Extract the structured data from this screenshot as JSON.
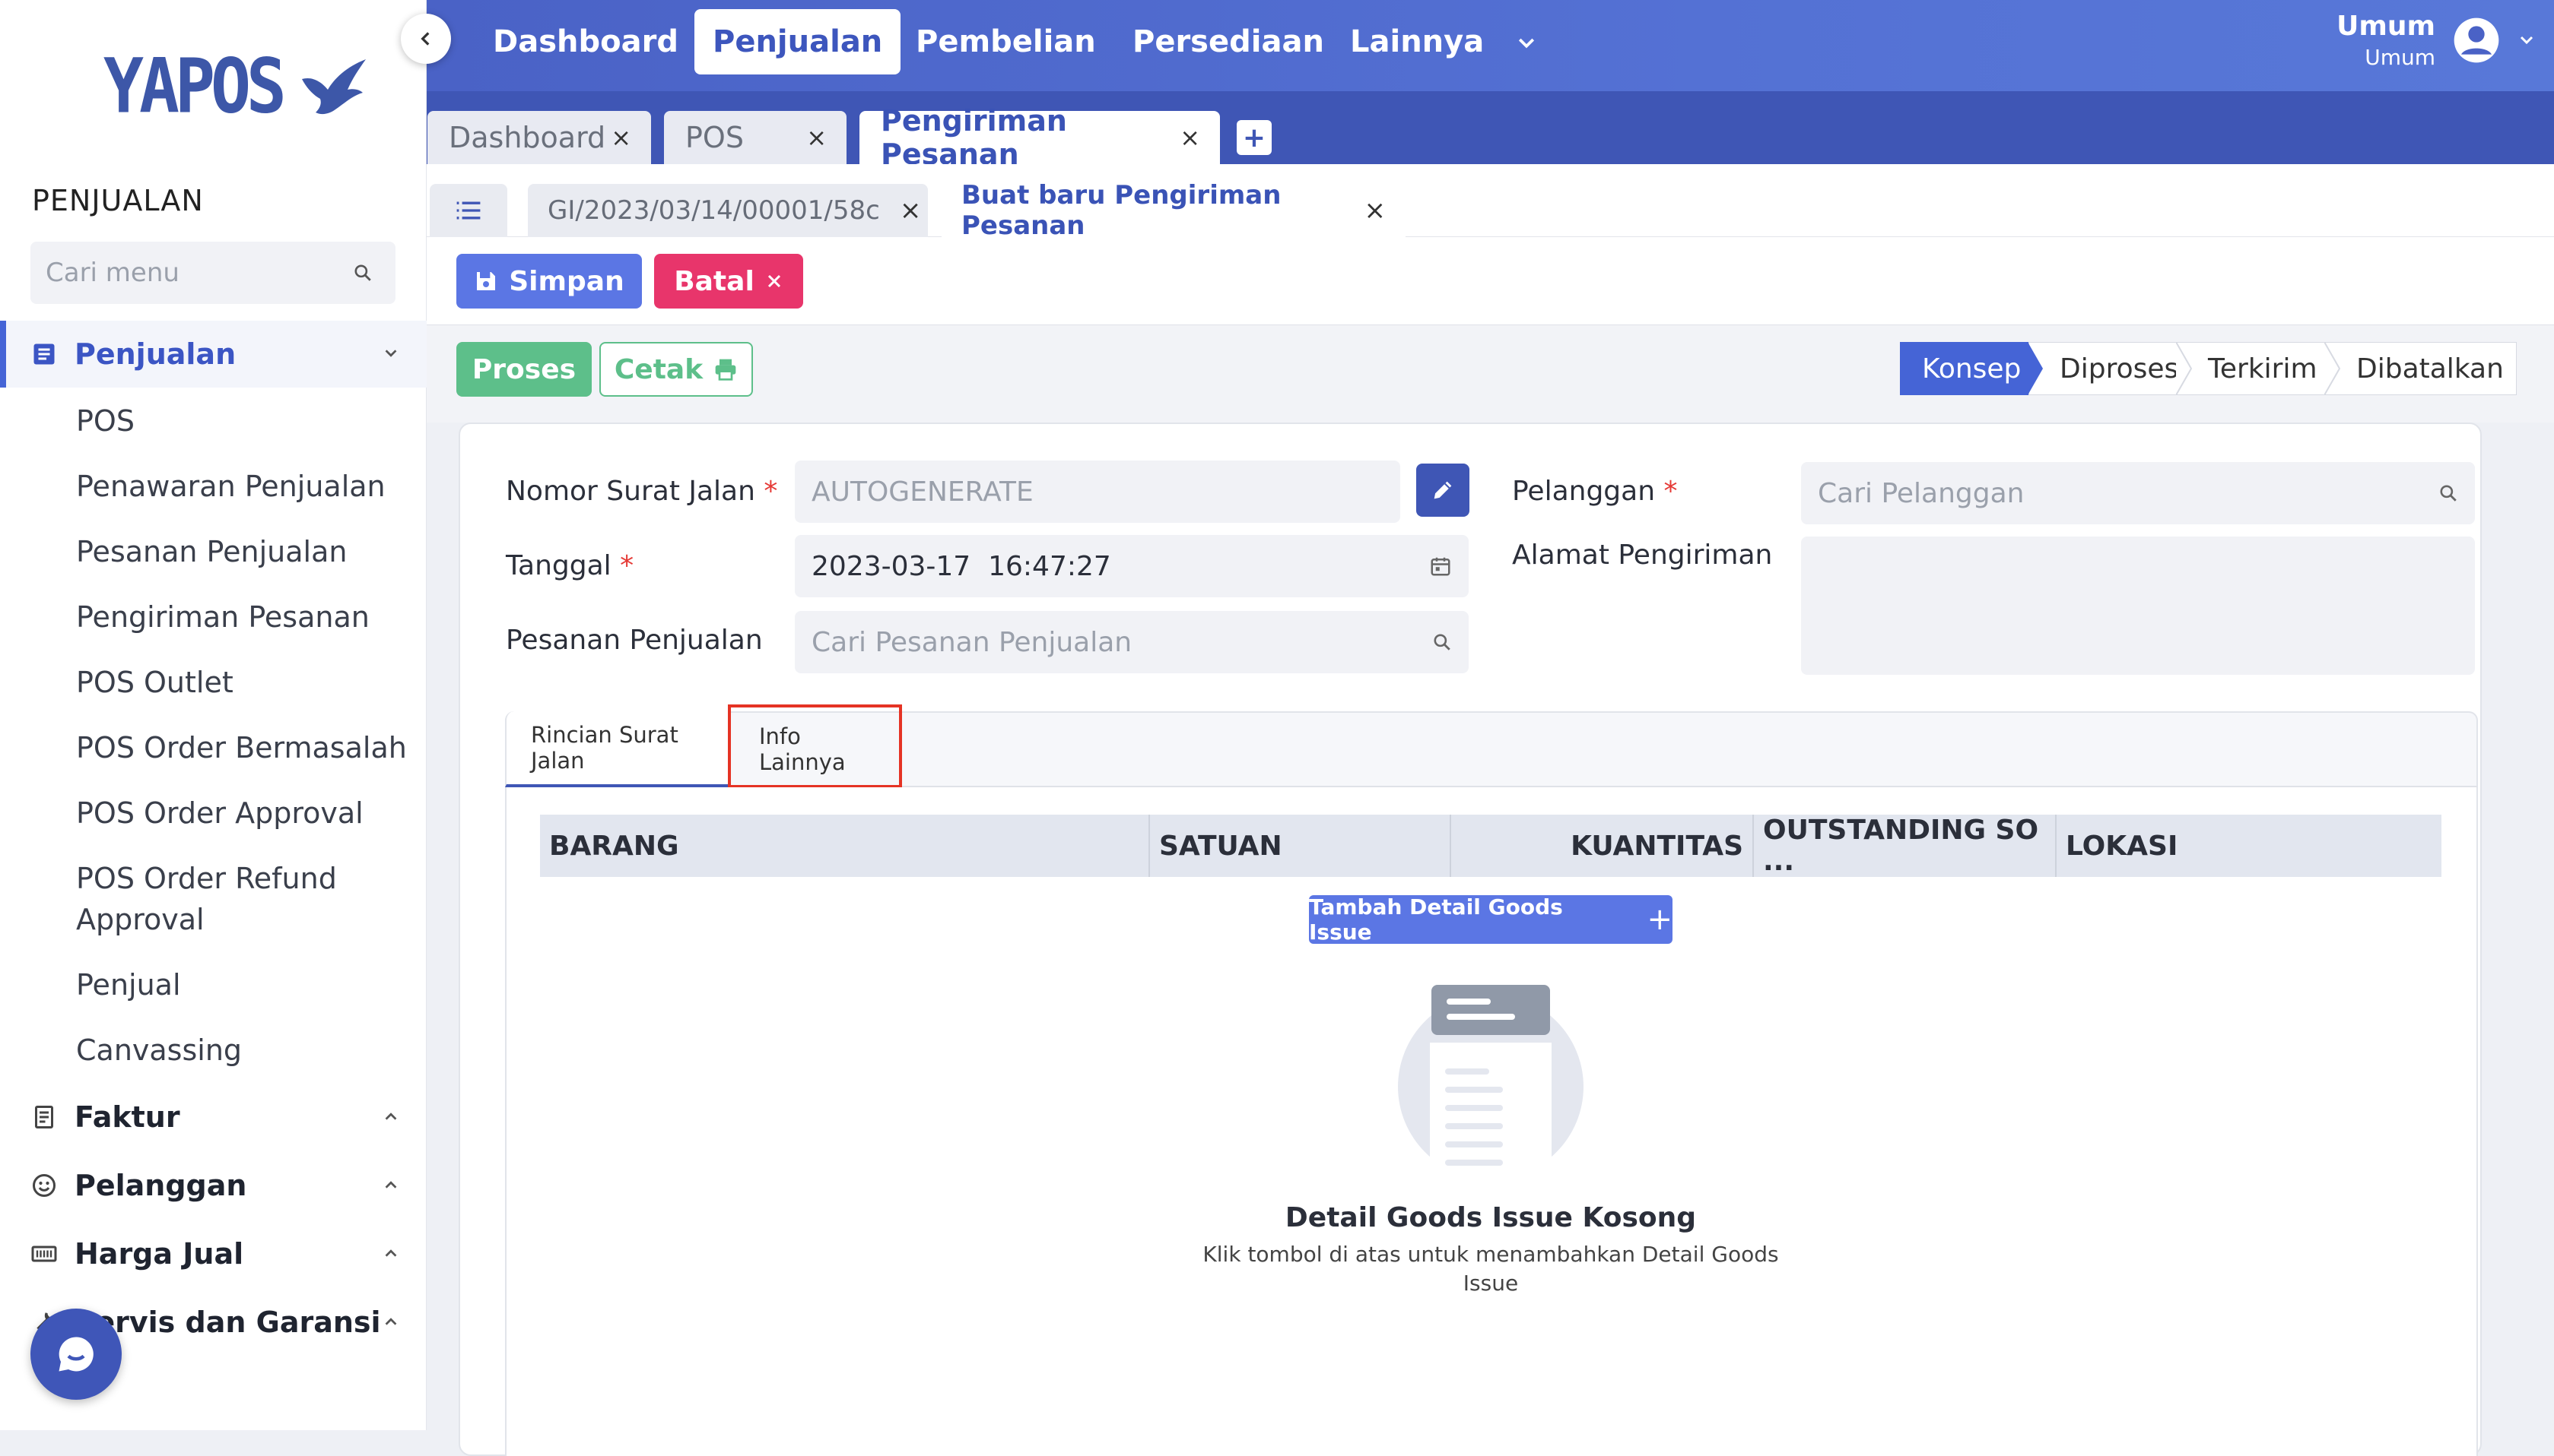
{
  "app": {
    "logo_text": "YAPOS"
  },
  "sidebar": {
    "section_title": "PENJUALAN",
    "search_placeholder": "Cari menu",
    "groups": [
      {
        "label": "Penjualan",
        "icon": "document-list-icon",
        "expanded": true
      },
      {
        "label": "Faktur",
        "icon": "receipt-icon"
      },
      {
        "label": "Pelanggan",
        "icon": "smiley-icon"
      },
      {
        "label": "Harga Jual",
        "icon": "price-tag-icon"
      },
      {
        "label": "Servis dan Garansi",
        "icon": "wrench-icon"
      }
    ],
    "penjualan_items": [
      "POS",
      "Penawaran Penjualan",
      "Pesanan Penjualan",
      "Pengiriman Pesanan",
      "POS Outlet",
      "POS Order Bermasalah",
      "POS Order Approval",
      "POS Order Refund Approval",
      "Penjual",
      "Canvassing"
    ]
  },
  "topnav": {
    "items": [
      "Dashboard",
      "Penjualan",
      "Pembelian",
      "Persediaan",
      "Lainnya"
    ],
    "active": "Penjualan",
    "user_name": "Umum",
    "user_role": "Umum"
  },
  "window_tabs": [
    {
      "label": "Dashboard",
      "close": "×"
    },
    {
      "label": "POS",
      "close": "×"
    },
    {
      "label": "Pengiriman Pesanan",
      "close": "×",
      "active": true
    }
  ],
  "window_tab_add": "+",
  "sub_tabs": [
    {
      "label": "GI/2023/03/14/00001/58c",
      "close": "×"
    },
    {
      "label": "Buat baru Pengiriman Pesanan",
      "close": "×",
      "active": true
    }
  ],
  "toolbar": {
    "save_label": "Simpan",
    "cancel_label": "Batal"
  },
  "actions": {
    "process_label": "Proses",
    "print_label": "Cetak"
  },
  "status_steps": [
    "Konsep",
    "Diproses",
    "Terkirim",
    "Dibatalkan"
  ],
  "form": {
    "nomor_label": "Nomor Surat Jalan",
    "nomor_value": "AUTOGENERATE",
    "tanggal_label": "Tanggal",
    "tanggal_value": "2023-03-17  16:47:27",
    "pesanan_label": "Pesanan Penjualan",
    "pesanan_placeholder": "Cari Pesanan Penjualan",
    "pelanggan_label": "Pelanggan",
    "pelanggan_placeholder": "Cari Pelanggan",
    "alamat_label": "Alamat Pengiriman",
    "required_mark": "*"
  },
  "inner_tabs": [
    {
      "label": "Rincian Surat Jalan",
      "active": true
    },
    {
      "label": "Info Lainnya",
      "highlighted": true
    }
  ],
  "table": {
    "columns": [
      "BARANG",
      "SATUAN",
      "KUANTITAS",
      "OUTSTANDING SO ...",
      "LOKASI"
    ]
  },
  "detail": {
    "add_button_label": "Tambah Detail Goods Issue",
    "add_icon": "+",
    "empty_title": "Detail Goods Issue Kosong",
    "empty_subtitle": "Klik tombol di atas untuk menambahkan Detail Goods Issue"
  },
  "colors": {
    "primary": "#4564d6",
    "topbar": "#4a62c6",
    "tabbar": "#3f56b5",
    "save": "#5b76e4",
    "cancel": "#e8356b",
    "process": "#5dbf8a",
    "highlight": "#e53324"
  }
}
